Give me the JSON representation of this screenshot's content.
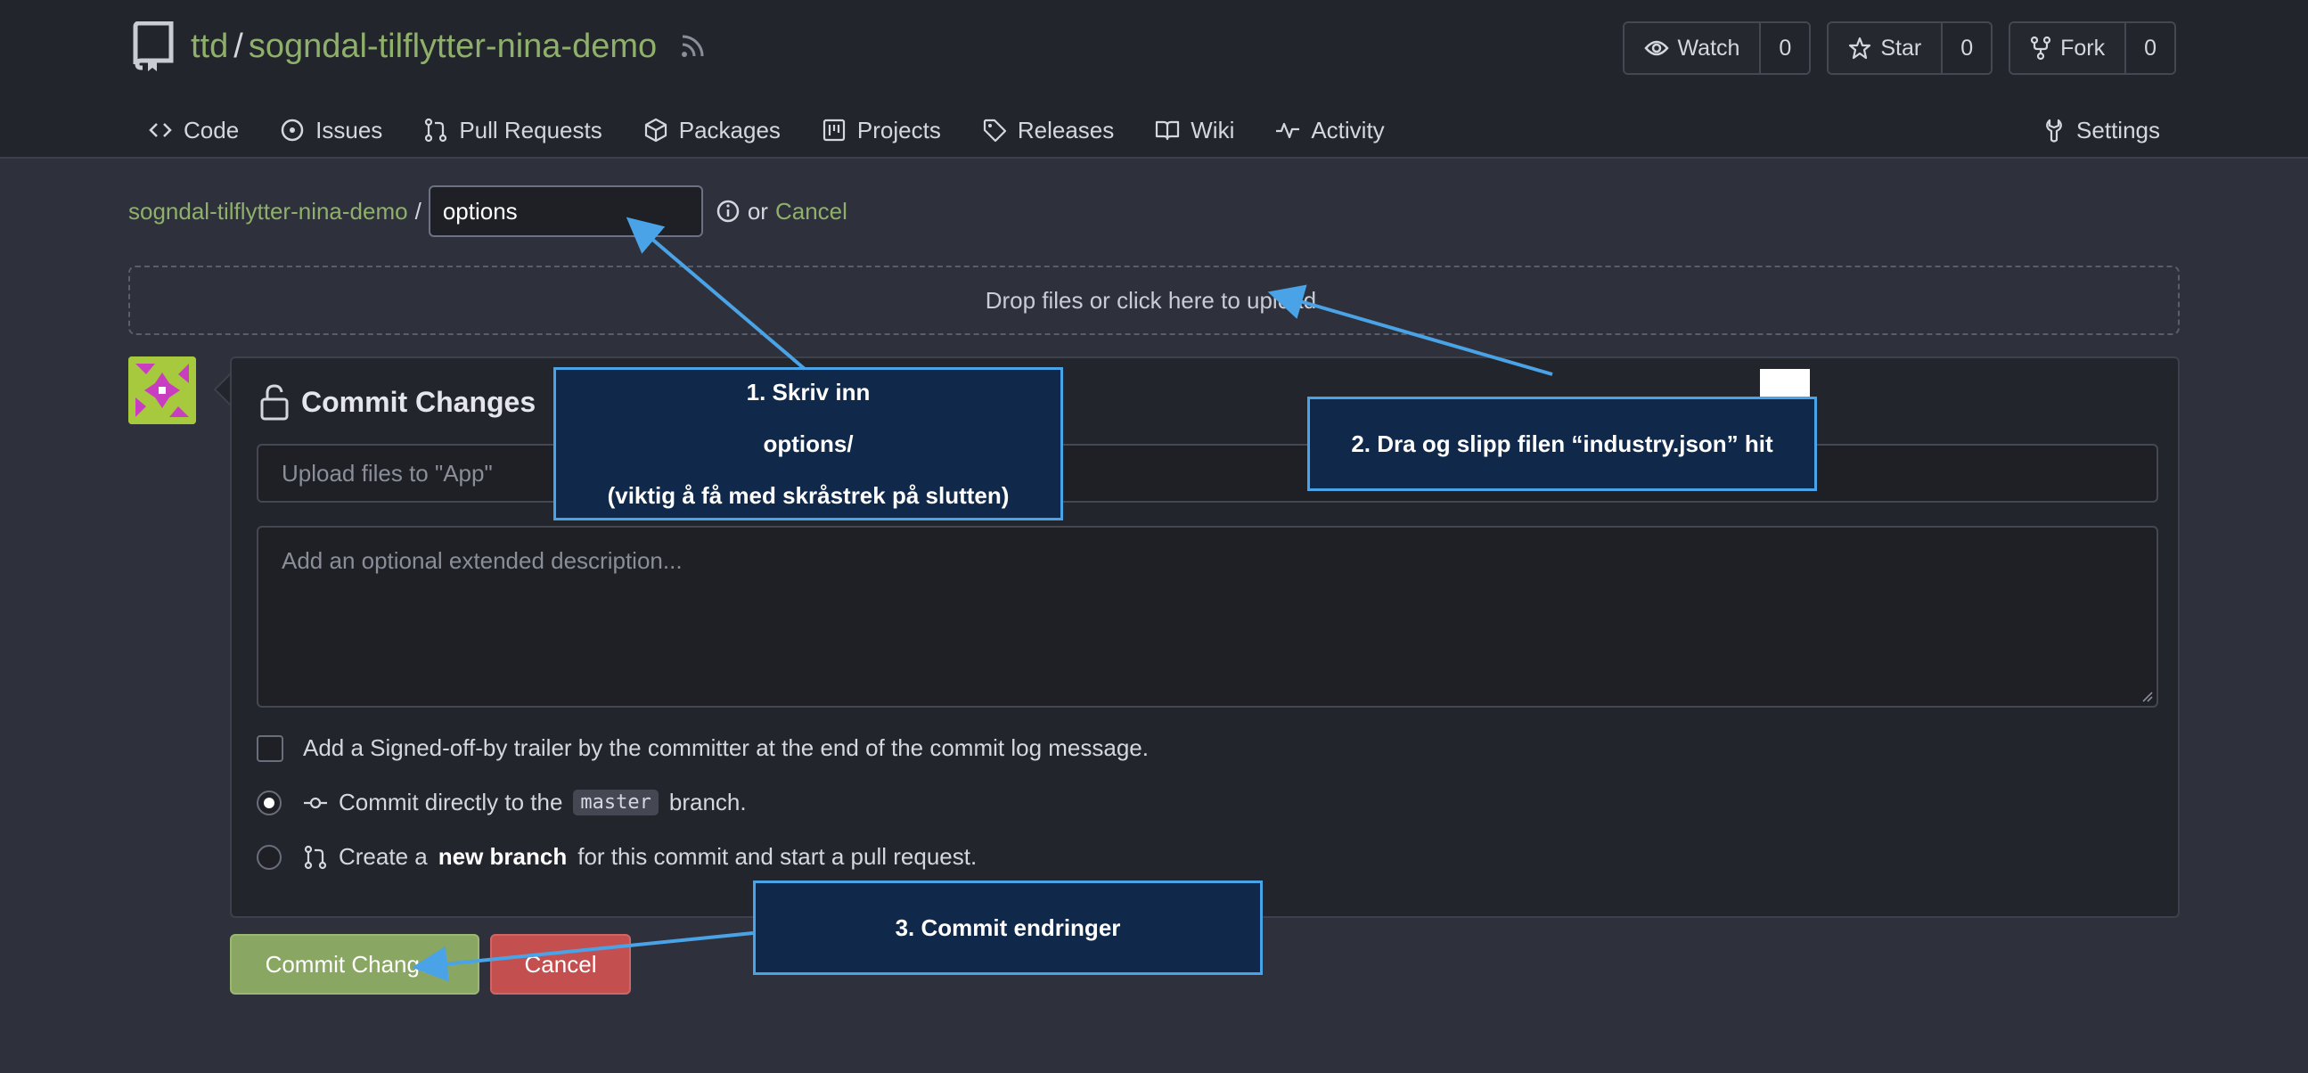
{
  "repo": {
    "owner": "ttd",
    "separator": "/",
    "name": "sogndal-tilflytter-nina-demo"
  },
  "header_buttons": [
    {
      "label": "Watch",
      "count": "0",
      "icon": "eye-icon"
    },
    {
      "label": "Star",
      "count": "0",
      "icon": "star-icon"
    },
    {
      "label": "Fork",
      "count": "0",
      "icon": "fork-icon"
    }
  ],
  "tabs": [
    {
      "label": "Code",
      "icon": "code-icon"
    },
    {
      "label": "Issues",
      "icon": "issue-icon"
    },
    {
      "label": "Pull Requests",
      "icon": "pull-request-icon"
    },
    {
      "label": "Packages",
      "icon": "package-icon"
    },
    {
      "label": "Projects",
      "icon": "project-icon"
    },
    {
      "label": "Releases",
      "icon": "tag-icon"
    },
    {
      "label": "Wiki",
      "icon": "book-icon"
    },
    {
      "label": "Activity",
      "icon": "pulse-icon"
    }
  ],
  "settings_label": "Settings",
  "breadcrumb": {
    "repo_link": "sogndal-tilflytter-nina-demo",
    "slash": "/",
    "path_value": "options",
    "or": "or",
    "cancel": "Cancel"
  },
  "dropzone_text": "Drop files or click here to upload.",
  "commit": {
    "heading": "Commit Changes",
    "summary_placeholder": "Upload files to \"App\"",
    "description_placeholder": "Add an optional extended description...",
    "signoff_label": "Add a Signed-off-by trailer by the committer at the end of the commit log message.",
    "direct_prefix": "Commit directly to the",
    "branch_name": "master",
    "direct_suffix": "branch.",
    "new_branch_prefix": "Create a",
    "new_branch_bold": "new branch",
    "new_branch_suffix": "for this commit and start a pull request.",
    "commit_button": "Commit Changes",
    "cancel_button": "Cancel"
  },
  "annotations": {
    "note1": {
      "line1": "1. Skriv inn",
      "line2": "options/",
      "line3": "(viktig å få med skråstrek på slutten)"
    },
    "note2": "2. Dra og slipp filen “industry.json” hit",
    "note3": "3. Commit endringer"
  },
  "colors": {
    "accent_green": "#8fb06a",
    "commit_button": "#89a663",
    "cancel_button": "#c44f4f",
    "annotation_border": "#4aa3e6",
    "annotation_fill": "#10294b"
  }
}
